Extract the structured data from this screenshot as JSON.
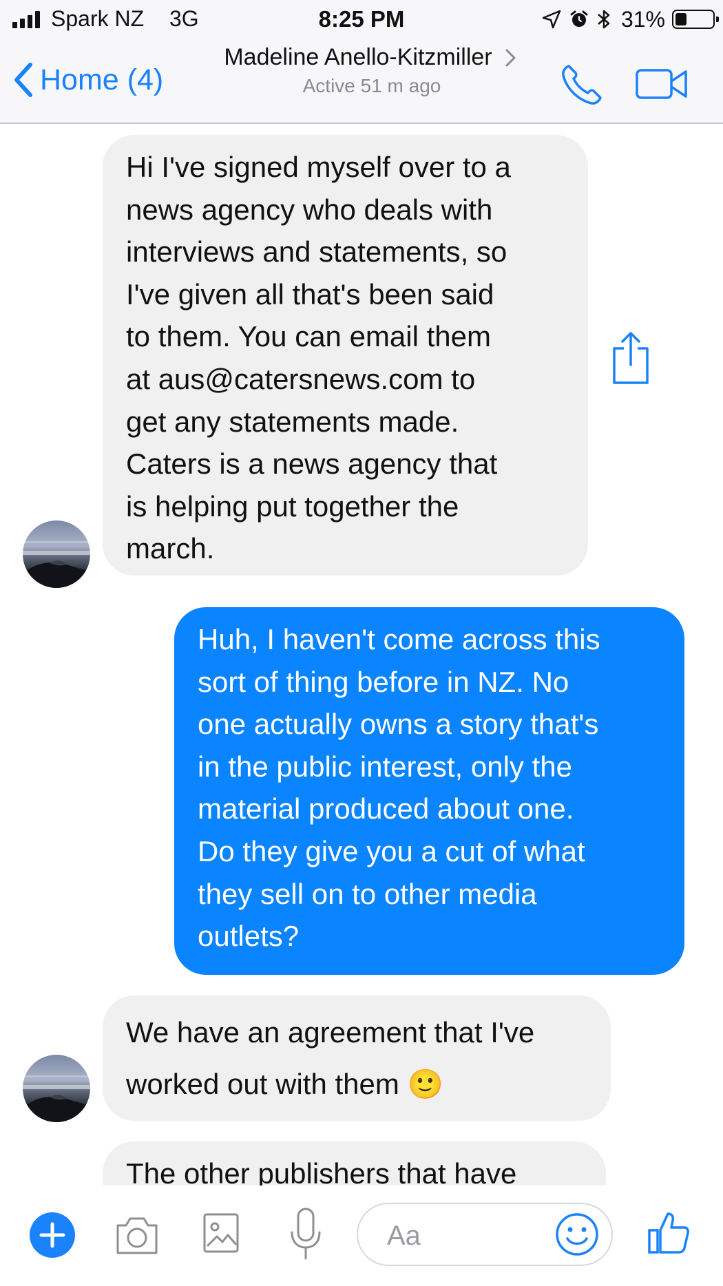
{
  "status_bar": {
    "carrier": "Spark NZ",
    "network": "3G",
    "time": "8:25 PM",
    "battery_percent": "31%",
    "battery_level": 0.31,
    "icons": [
      "signal-icon",
      "location-icon",
      "alarm-icon",
      "bluetooth-icon",
      "battery-icon"
    ]
  },
  "header": {
    "back_label": "Home (4)",
    "contact_name": "Madeline Anello-Kitzmiller",
    "contact_status": "Active 51 m ago",
    "icons": [
      "chevron-left-icon",
      "chevron-right-icon",
      "phone-icon",
      "video-camera-icon"
    ]
  },
  "messages": [
    {
      "direction": "incoming",
      "lines": [
        "Hi I've signed myself over to a",
        "news agency who deals with",
        "interviews and statements, so",
        "I've given all that's been said",
        "to them. You can email them",
        "at aus@catersnews.com to",
        "get any statements made.",
        "Caters is a news agency that",
        "is helping put together the",
        "march."
      ]
    },
    {
      "direction": "outgoing",
      "lines": [
        "Huh, I haven't come across this",
        "sort of thing before in NZ. No",
        "one actually owns a story that's",
        "in the public interest, only the",
        "material produced about one.",
        "Do they give you a cut of what",
        "they sell on to other media",
        "outlets?"
      ]
    },
    {
      "direction": "incoming",
      "lines": [
        "We have an agreement that I've",
        "worked out with them 🙂"
      ]
    },
    {
      "direction": "incoming",
      "lines": [
        "The other publishers that have"
      ]
    }
  ],
  "composer": {
    "placeholder": "Aa",
    "icons": [
      "plus-icon",
      "camera-icon",
      "image-icon",
      "microphone-icon",
      "emoji-icon",
      "thumbs-up-icon"
    ]
  },
  "colors": {
    "accent": "#0a84ff",
    "incoming_bubble": "#f1f0f0",
    "link_blue": "#1a82fb"
  }
}
